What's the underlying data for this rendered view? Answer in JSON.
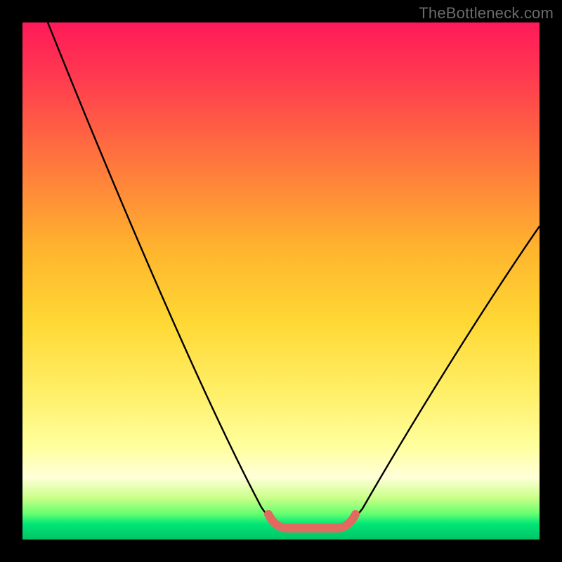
{
  "watermark": "TheBottleneck.com",
  "colors": {
    "curve": "#000000",
    "valley_marker": "#e06a60",
    "frame": "#000000"
  },
  "chart_data": {
    "type": "line",
    "title": "",
    "xlabel": "",
    "ylabel": "",
    "xlim": [
      0,
      100
    ],
    "ylim": [
      0,
      100
    ],
    "grid": false,
    "series": [
      {
        "name": "bottleneck-curve",
        "x": [
          0,
          5,
          10,
          15,
          20,
          25,
          30,
          35,
          40,
          45,
          48,
          50,
          52,
          55,
          58,
          60,
          63,
          65,
          70,
          75,
          80,
          85,
          90,
          95,
          100
        ],
        "y": [
          100,
          90,
          80,
          70,
          60,
          50,
          40,
          30,
          20,
          10,
          4,
          1,
          0,
          0,
          0,
          1,
          3,
          5,
          11,
          18,
          26,
          34,
          43,
          52,
          61
        ]
      }
    ],
    "annotations": [
      {
        "name": "valley-flat",
        "x_range": [
          50,
          60
        ],
        "y": 0,
        "note": "thick coral segment marking the sweet-spot minimum"
      }
    ]
  }
}
